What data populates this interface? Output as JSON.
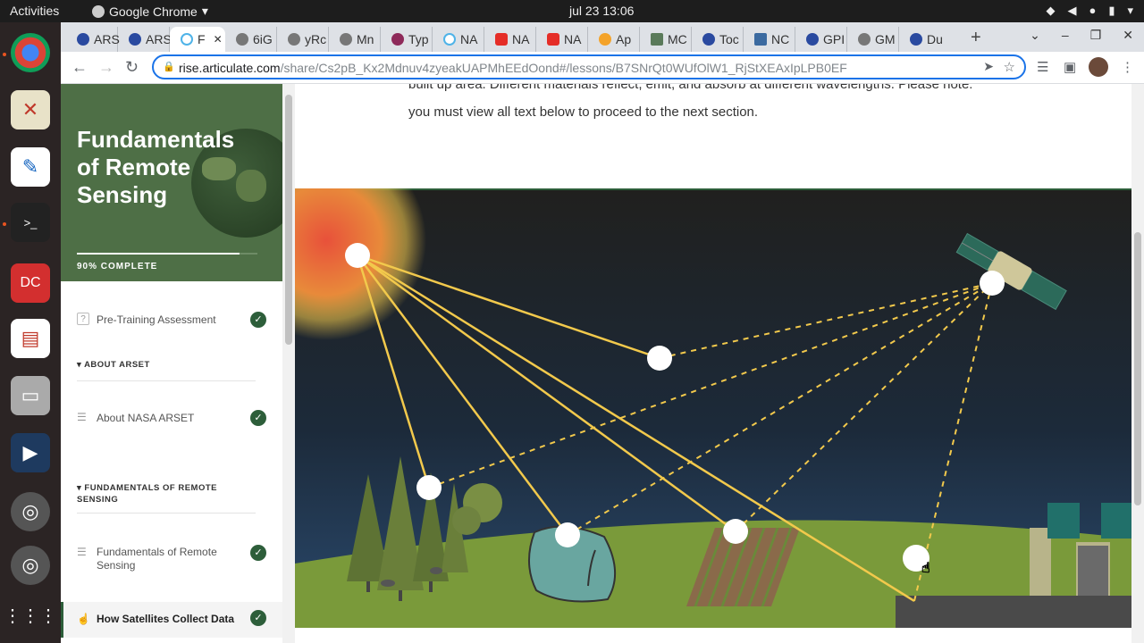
{
  "system": {
    "activities": "Activities",
    "app_name": "Google Chrome",
    "clock": "jul 23  13:06"
  },
  "tabs": [
    {
      "label": "ARS",
      "active": false
    },
    {
      "label": "ARS",
      "active": false
    },
    {
      "label": "F",
      "active": true
    },
    {
      "label": "6iG",
      "active": false
    },
    {
      "label": "yRc",
      "active": false
    },
    {
      "label": "Mn",
      "active": false
    },
    {
      "label": "Typ",
      "active": false
    },
    {
      "label": "NA",
      "active": false
    },
    {
      "label": "NA",
      "active": false
    },
    {
      "label": "NA",
      "active": false
    },
    {
      "label": "Ap",
      "active": false
    },
    {
      "label": "MC",
      "active": false
    },
    {
      "label": "Toc",
      "active": false
    },
    {
      "label": "NC",
      "active": false
    },
    {
      "label": "GPI",
      "active": false
    },
    {
      "label": "GM",
      "active": false
    },
    {
      "label": "Du",
      "active": false
    }
  ],
  "omnibox": {
    "host": "rise.articulate.com",
    "path": "/share/Cs2pB_Kx2Mdnuv4zyeakUAPMhEEdOond#/lessons/B7SNrQt0WUfOlW1_RjStXEAxIpLPB0EF"
  },
  "course": {
    "title": "Fundamentals of Remote Sensing",
    "progress_label": "90% COMPLETE",
    "progress": 0.9
  },
  "sidebar": {
    "lesson_preassessment": "Pre-Training Assessment",
    "section_about": "ABOUT ARSET",
    "lesson_about": "About NASA ARSET",
    "section_fundamentals": "FUNDAMENTALS OF REMOTE SENSING",
    "lesson_fundamentals": "Fundamentals of Remote Sensing",
    "lesson_satellites": "How Satellites Collect Data"
  },
  "main": {
    "line1": "built up area. Different materials reflect, emit, and absorb at different wavelengths.  Please note:",
    "line2": "you must view all text below to proceed to the next section."
  },
  "colors": {
    "sidebar_green": "#4e6f46",
    "check_green": "#2d5e3a",
    "sun_ray": "#f2c94c",
    "ground": "#7a9a3a"
  },
  "icons": [
    "chrome-icon",
    "sun-icon",
    "satellite-icon",
    "check-icon",
    "hotspot-icon"
  ]
}
